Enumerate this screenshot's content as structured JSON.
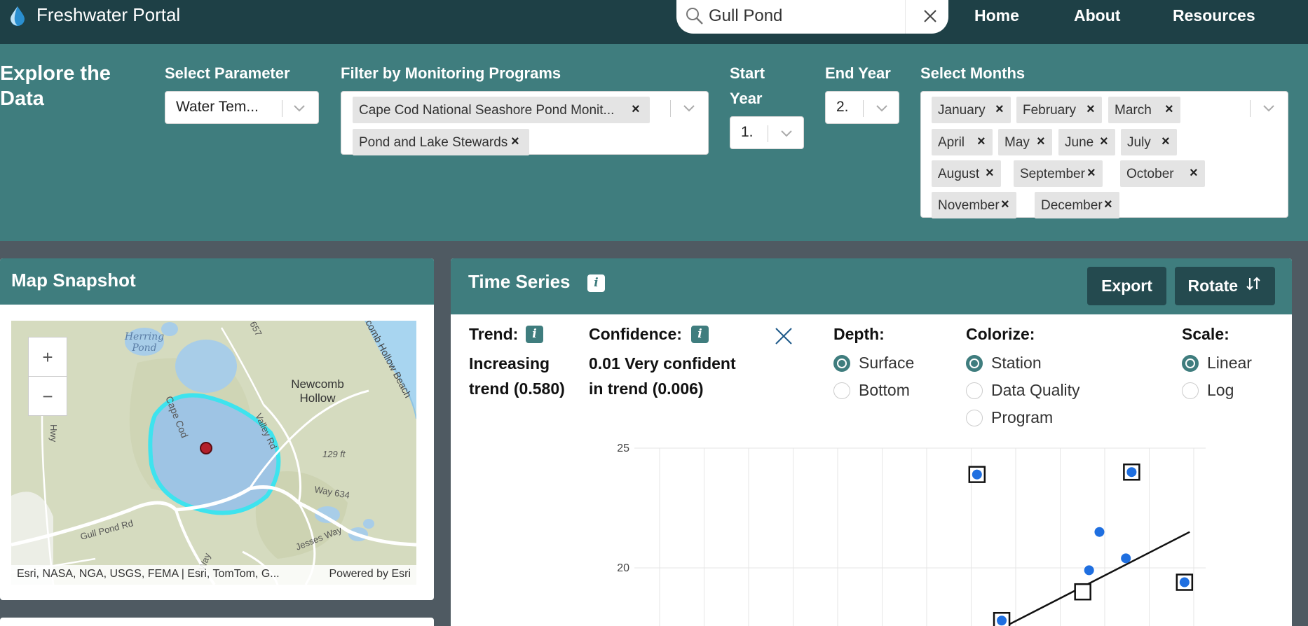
{
  "nav": {
    "brand_title": "Freshwater Portal",
    "search_value": "Gull Pond",
    "links": [
      "Home",
      "About",
      "Resources"
    ]
  },
  "filters": {
    "explore_title_line1": "Explore the",
    "explore_title_line2": "Data",
    "parameter_label": "Select Parameter",
    "parameter_value": "Water Tem...",
    "programs_label": "Filter by Monitoring Programs",
    "programs": [
      "Cape Cod National Seashore Pond Monit...",
      "Pond and Lake Stewards"
    ],
    "start_year_label_line1": "Start",
    "start_year_label_line2": "Year",
    "start_year_value": "1.",
    "end_year_label": "End Year",
    "end_year_value": "2.",
    "months_label": "Select Months",
    "months": [
      "January",
      "February",
      "March",
      "April",
      "May",
      "June",
      "July",
      "August",
      "September",
      "October",
      "November",
      "December"
    ],
    "chip_remove_glyph": "×"
  },
  "map_panel": {
    "title": "Map Snapshot",
    "zoom_in": "+",
    "zoom_out": "−",
    "labels": {
      "herring_pond_1": "Herring",
      "herring_pond_2": "Pond",
      "newcomb_1": "Newcomb",
      "newcomb_2": "Hollow",
      "cape_cod": "Cape Cod",
      "valley_rd": "Valley Rd",
      "elevation": "129 ft",
      "way_634": "Way 634",
      "gull_pond_rd": "Gull Pond Rd",
      "jesses_way": "Jesses Way",
      "newcomb_hollow_beach": "comb Hollow Beach",
      "route_657": "657",
      "hwy": "Hwy",
      "h_way": "h Way"
    },
    "attribution_left": "Esri, NASA, NGA, USGS, FEMA | Esri, TomTom, G...",
    "attribution_right": "Powered by Esri"
  },
  "time_series": {
    "title": "Time Series",
    "export_label": "Export",
    "rotate_label": "Rotate",
    "trend_label": "Trend:",
    "trend_value_line1": "Increasing",
    "trend_value_line2": "trend (0.580)",
    "confidence_label": "Confidence:",
    "confidence_value_line1": "0.01 Very confident",
    "confidence_value_line2": "in trend (0.006)",
    "info_glyph": "i",
    "depth_label": "Depth:",
    "depth_options": [
      "Surface",
      "Bottom"
    ],
    "depth_selected": "Surface",
    "colorize_label": "Colorize:",
    "colorize_options": [
      "Station",
      "Data Quality",
      "Program"
    ],
    "colorize_selected": "Station",
    "scale_label": "Scale:",
    "scale_options": [
      "Linear",
      "Log"
    ],
    "scale_selected": "Linear"
  },
  "chart_data": {
    "type": "scatter",
    "ylim": [
      17.5,
      25
    ],
    "yticks": [
      20,
      25
    ],
    "grid": true,
    "point_color": "#1f6fe0",
    "points": [
      {
        "slot": 0.59,
        "y": 23.9,
        "boxed": true
      },
      {
        "slot": 0.633,
        "y": 17.8,
        "boxed": true
      },
      {
        "slot": 0.803,
        "y": 21.5,
        "boxed": false
      },
      {
        "slot": 0.785,
        "y": 19.9,
        "boxed": false
      },
      {
        "slot": 0.849,
        "y": 20.4,
        "boxed": false
      },
      {
        "slot": 0.859,
        "y": 24.0,
        "boxed": true
      },
      {
        "slot": 0.951,
        "y": 19.4,
        "boxed": true
      }
    ],
    "open_markers": [
      {
        "slot": 0.774,
        "y": 19.0
      }
    ],
    "trend_line": {
      "from": {
        "slot": 0.61,
        "y": 17.2
      },
      "to": {
        "slot": 0.96,
        "y": 21.5
      }
    }
  }
}
